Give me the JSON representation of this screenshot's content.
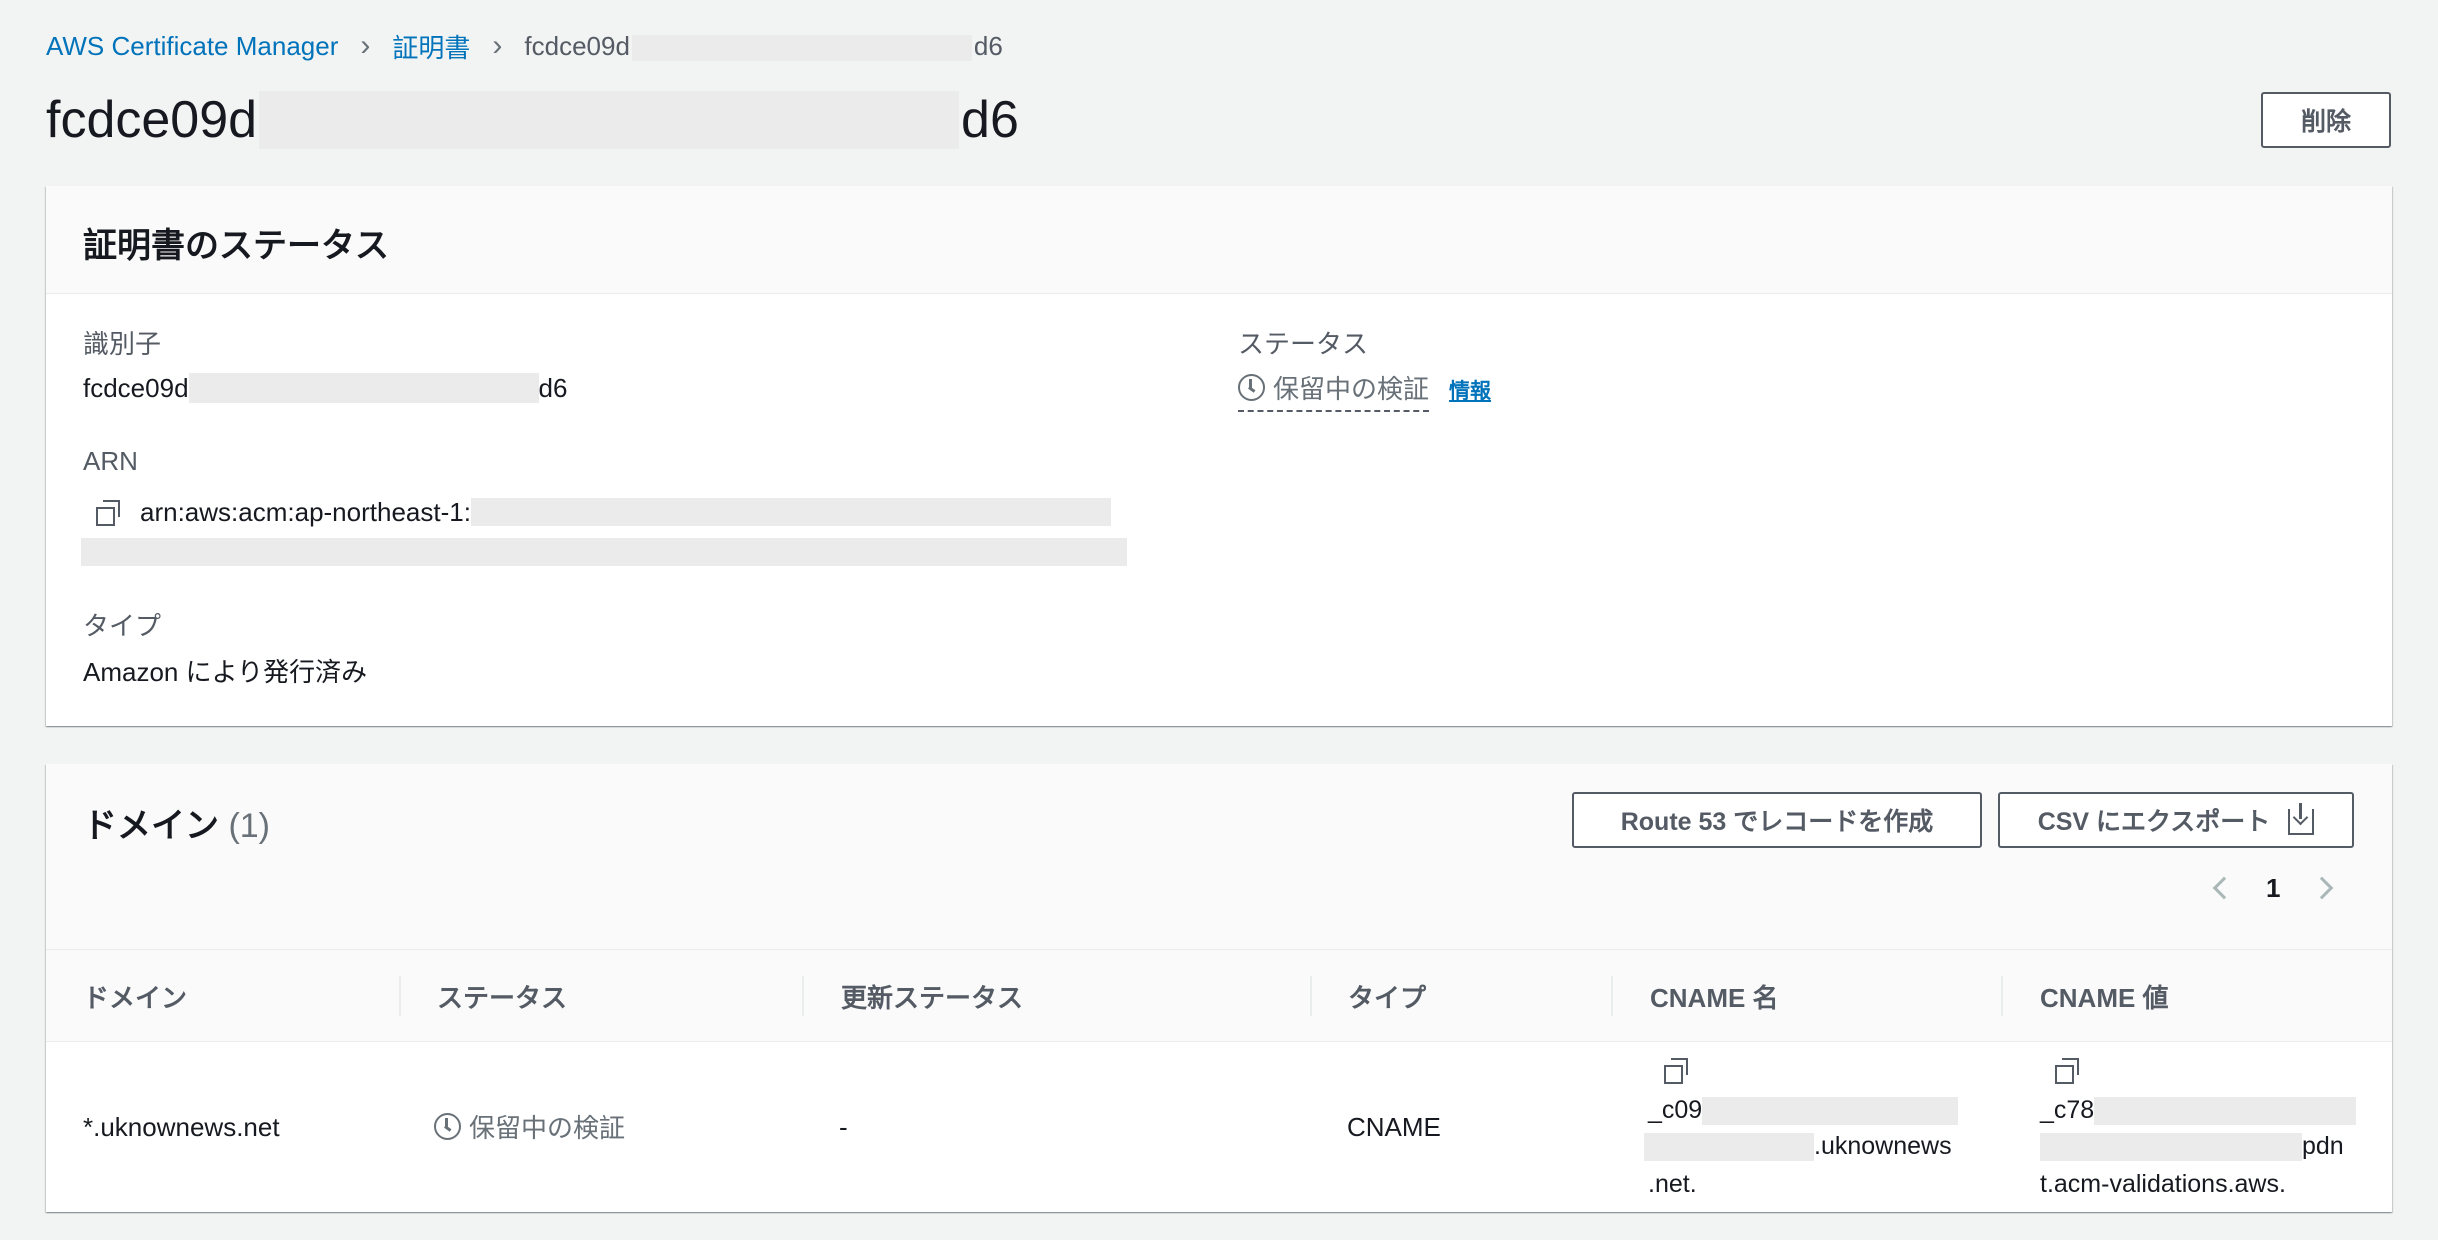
{
  "breadcrumb": {
    "root": "AWS Certificate Manager",
    "section": "証明書",
    "current_prefix": "fcdce09d",
    "current_suffix": "d6"
  },
  "page": {
    "title_prefix": "fcdce09d",
    "title_suffix": "d6",
    "delete_label": "削除"
  },
  "status_panel": {
    "title": "証明書のステータス",
    "identifier_label": "識別子",
    "identifier_prefix": "fcdce09d",
    "identifier_suffix": "d6",
    "arn_label": "ARN",
    "arn_value": "arn:aws:acm:ap-northeast-1:",
    "type_label": "タイプ",
    "type_value": "Amazon により発行済み",
    "status_label": "ステータス",
    "status_value": "保留中の検証",
    "info_link": "情報"
  },
  "domain_panel": {
    "title": "ドメイン",
    "count": "(1)",
    "route53_button": "Route 53 でレコードを作成",
    "csv_button": "CSV にエクスポート",
    "page_number": "1",
    "columns": [
      "ドメイン",
      "ステータス",
      "更新ステータス",
      "タイプ",
      "CNAME 名",
      "CNAME 値"
    ],
    "row": {
      "domain": "*.uknownews.net",
      "status": "保留中の検証",
      "renewal_status": "-",
      "type": "CNAME",
      "cname_name_line1": "_c09",
      "cname_name_line2": ".uknownews",
      "cname_name_line3": ".net.",
      "cname_value_line1": "_c78",
      "cname_value_line2": "pdn",
      "cname_value_line3": "t.acm-validations.aws."
    }
  }
}
